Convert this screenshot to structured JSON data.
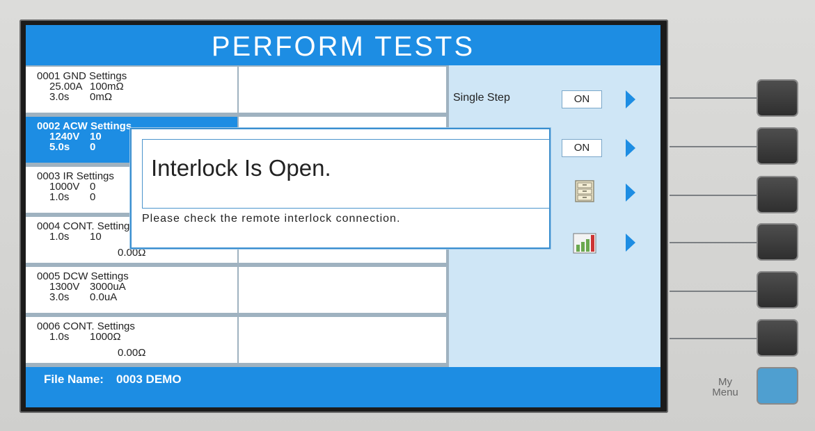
{
  "screen_title": "PERFORM TESTS",
  "tests": [
    {
      "line1": "0001  GND  Settings",
      "line2a": "25.00A",
      "line2b": "100mΩ",
      "line3a": "3.0s",
      "line3b": "0mΩ",
      "line4b": ""
    },
    {
      "line1": "0002  ACW  Settings",
      "line2a": "1240V",
      "line2b": "10",
      "line3a": "5.0s",
      "line3b": "0",
      "line4b": ""
    },
    {
      "line1": "0003  IR  Settings",
      "line2a": "1000V",
      "line2b": "0",
      "line3a": "1.0s",
      "line3b": "0",
      "line4b": ""
    },
    {
      "line1": "0004  CONT.  Settings",
      "line2a": "1.0s",
      "line2b": "10",
      "line3a": "",
      "line3b": "",
      "line4b": "0.00Ω"
    },
    {
      "line1": "0005  DCW  Settings",
      "line2a": "1300V",
      "line2b": "3000uA",
      "line3a": "3.0s",
      "line3b": "0.0uA",
      "line4b": ""
    },
    {
      "line1": "0006  CONT.  Settings",
      "line2a": "1.0s",
      "line2b": "1000Ω",
      "line3a": "",
      "line3b": "",
      "line4b": "0.00Ω"
    }
  ],
  "right_panel": {
    "single_step_label": "Single Step",
    "single_step_value": "ON",
    "second_value": "ON"
  },
  "footer": {
    "file_label": "File Name:",
    "file_value": "0003  DEMO"
  },
  "dialog": {
    "message": "Interlock Is Open.",
    "sub_message": "Please check the remote interlock connection."
  },
  "my_menu_label": "My Menu",
  "colors": {
    "accent": "#1d8de3",
    "panel": "#cfe6f6"
  }
}
